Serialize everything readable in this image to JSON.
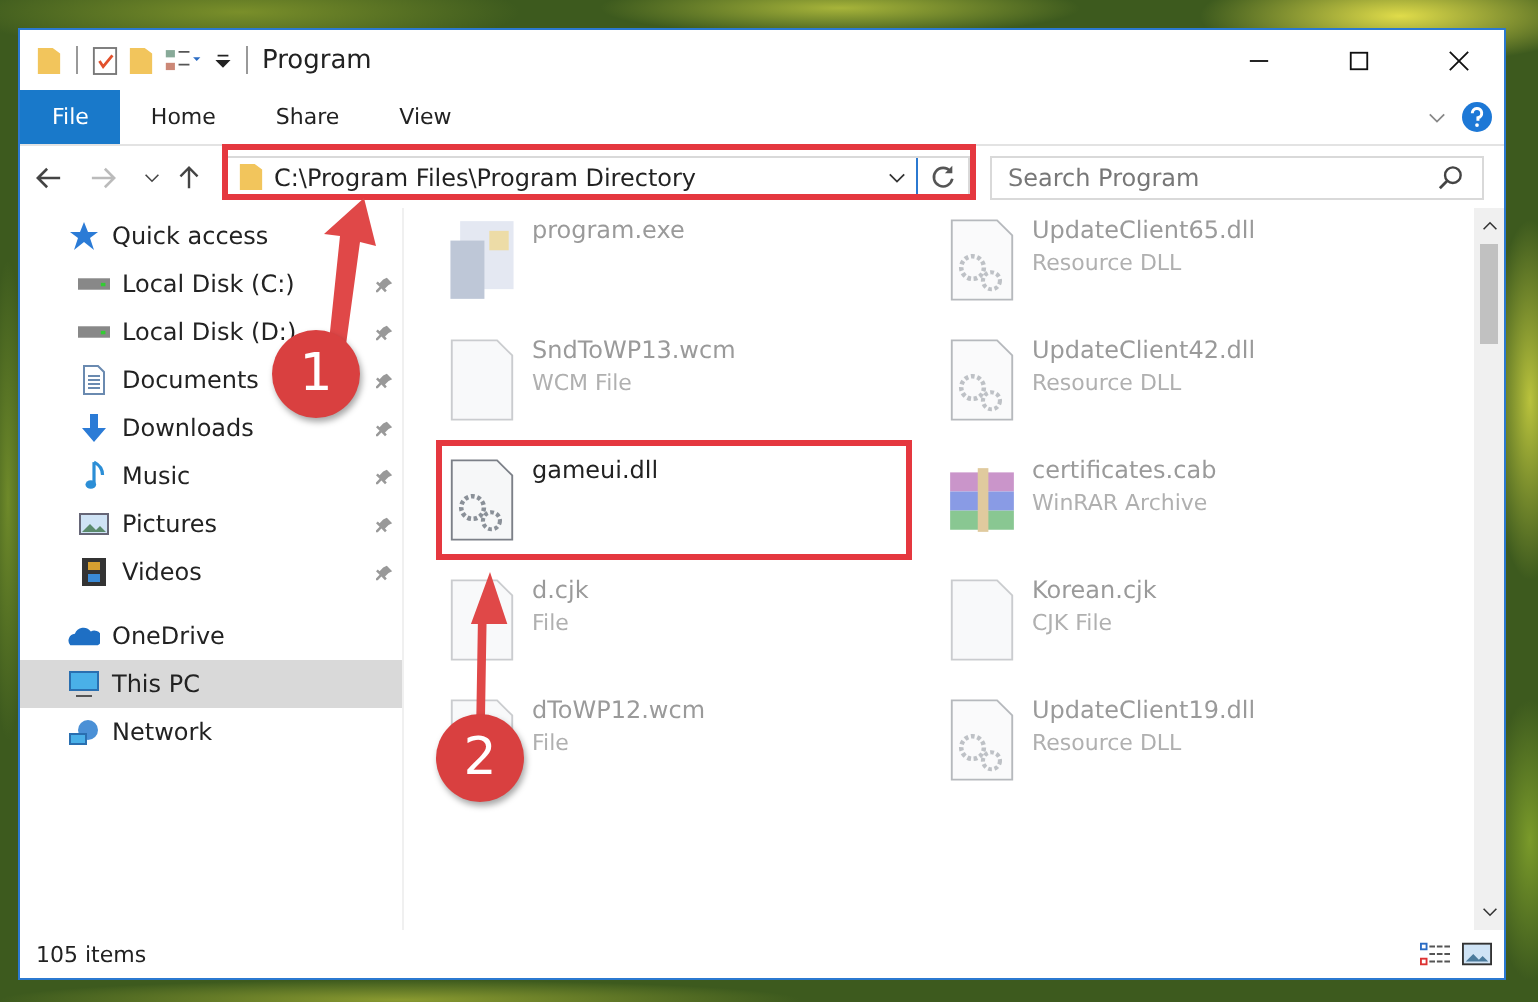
{
  "window": {
    "title": "Program"
  },
  "ribbon": {
    "tabs": [
      {
        "label": "File",
        "selected": true
      },
      {
        "label": "Home",
        "selected": false
      },
      {
        "label": "Share",
        "selected": false
      },
      {
        "label": "View",
        "selected": false
      }
    ]
  },
  "address_bar": {
    "path": "C:\\Program Files\\Program Directory"
  },
  "search": {
    "placeholder": "Search Program"
  },
  "sidebar": {
    "items": [
      {
        "label": "Quick access",
        "kind": "star",
        "selected": false,
        "children": [
          {
            "label": "Local Disk (C:)",
            "kind": "disk",
            "pinned": true
          },
          {
            "label": "Local Disk (D:)",
            "kind": "disk",
            "pinned": true
          },
          {
            "label": "Documents",
            "kind": "documents",
            "pinned": true
          },
          {
            "label": "Downloads",
            "kind": "downloads",
            "pinned": true
          },
          {
            "label": "Music",
            "kind": "music",
            "pinned": true
          },
          {
            "label": "Pictures",
            "kind": "pictures",
            "pinned": true
          },
          {
            "label": "Videos",
            "kind": "videos",
            "pinned": true
          }
        ]
      },
      {
        "label": "OneDrive",
        "kind": "cloud",
        "selected": false
      },
      {
        "label": "This PC",
        "kind": "pc",
        "selected": true
      },
      {
        "label": "Network",
        "kind": "network",
        "selected": false
      }
    ]
  },
  "files": [
    {
      "name": "program.exe",
      "kind": "exe",
      "highlighted": false
    },
    {
      "name": "UpdateClient65.dll",
      "type": "Resource DLL",
      "kind": "dll",
      "highlighted": false
    },
    {
      "name": "SndToWP13.wcm",
      "type": "WCM File",
      "kind": "blank",
      "highlighted": false
    },
    {
      "name": "UpdateClient42.dll",
      "type": "Resource DLL",
      "kind": "dll",
      "highlighted": false
    },
    {
      "name": "gameui.dll",
      "kind": "dll",
      "highlighted": true
    },
    {
      "name": "certificates.cab",
      "type": "WinRAR Archive",
      "kind": "archive",
      "highlighted": false
    },
    {
      "name": "d.cjk",
      "type": "File",
      "kind": "blank",
      "highlighted": false
    },
    {
      "name": "Korean.cjk",
      "type": "CJK File",
      "kind": "blank",
      "highlighted": false
    },
    {
      "name": "dToWP12.wcm",
      "type": "File",
      "kind": "blank",
      "highlighted": false
    },
    {
      "name": "UpdateClient19.dll",
      "type": "Resource DLL",
      "kind": "dll",
      "highlighted": false
    }
  ],
  "status_bar": {
    "item_count": "105 items"
  },
  "annotations": [
    {
      "number": "1"
    },
    {
      "number": "2"
    }
  ]
}
